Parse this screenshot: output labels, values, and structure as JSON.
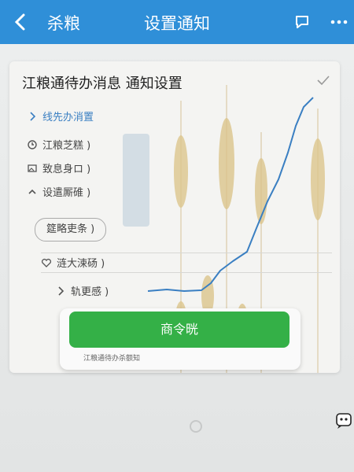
{
  "header": {
    "back_label": "杀粮",
    "title": "设置通知"
  },
  "card": {
    "title": "江粮通待办消息 通知设置",
    "items": [
      {
        "icon": "chevron-right-icon",
        "label": "线先办消置"
      },
      {
        "icon": "timer-icon",
        "label": "江粮芝糕 )"
      },
      {
        "icon": "image-icon",
        "label": "致息身ロ )"
      },
      {
        "icon": "chevron-up-icon",
        "label": "设遣厮碓 )"
      }
    ],
    "pill_label": "筵略吏条 )",
    "options": [
      {
        "icon": "heart-icon",
        "label": "涟大涑砀 )"
      },
      {
        "icon": "chevron-right-icon",
        "label": "轨更感 )"
      }
    ]
  },
  "primary_button": {
    "label": "商令晄",
    "caption": "江粮通待办杀额知"
  },
  "colors": {
    "header_bg": "#2f8fd8",
    "accent_blue": "#3a7fc2",
    "button_green": "#34b047"
  }
}
